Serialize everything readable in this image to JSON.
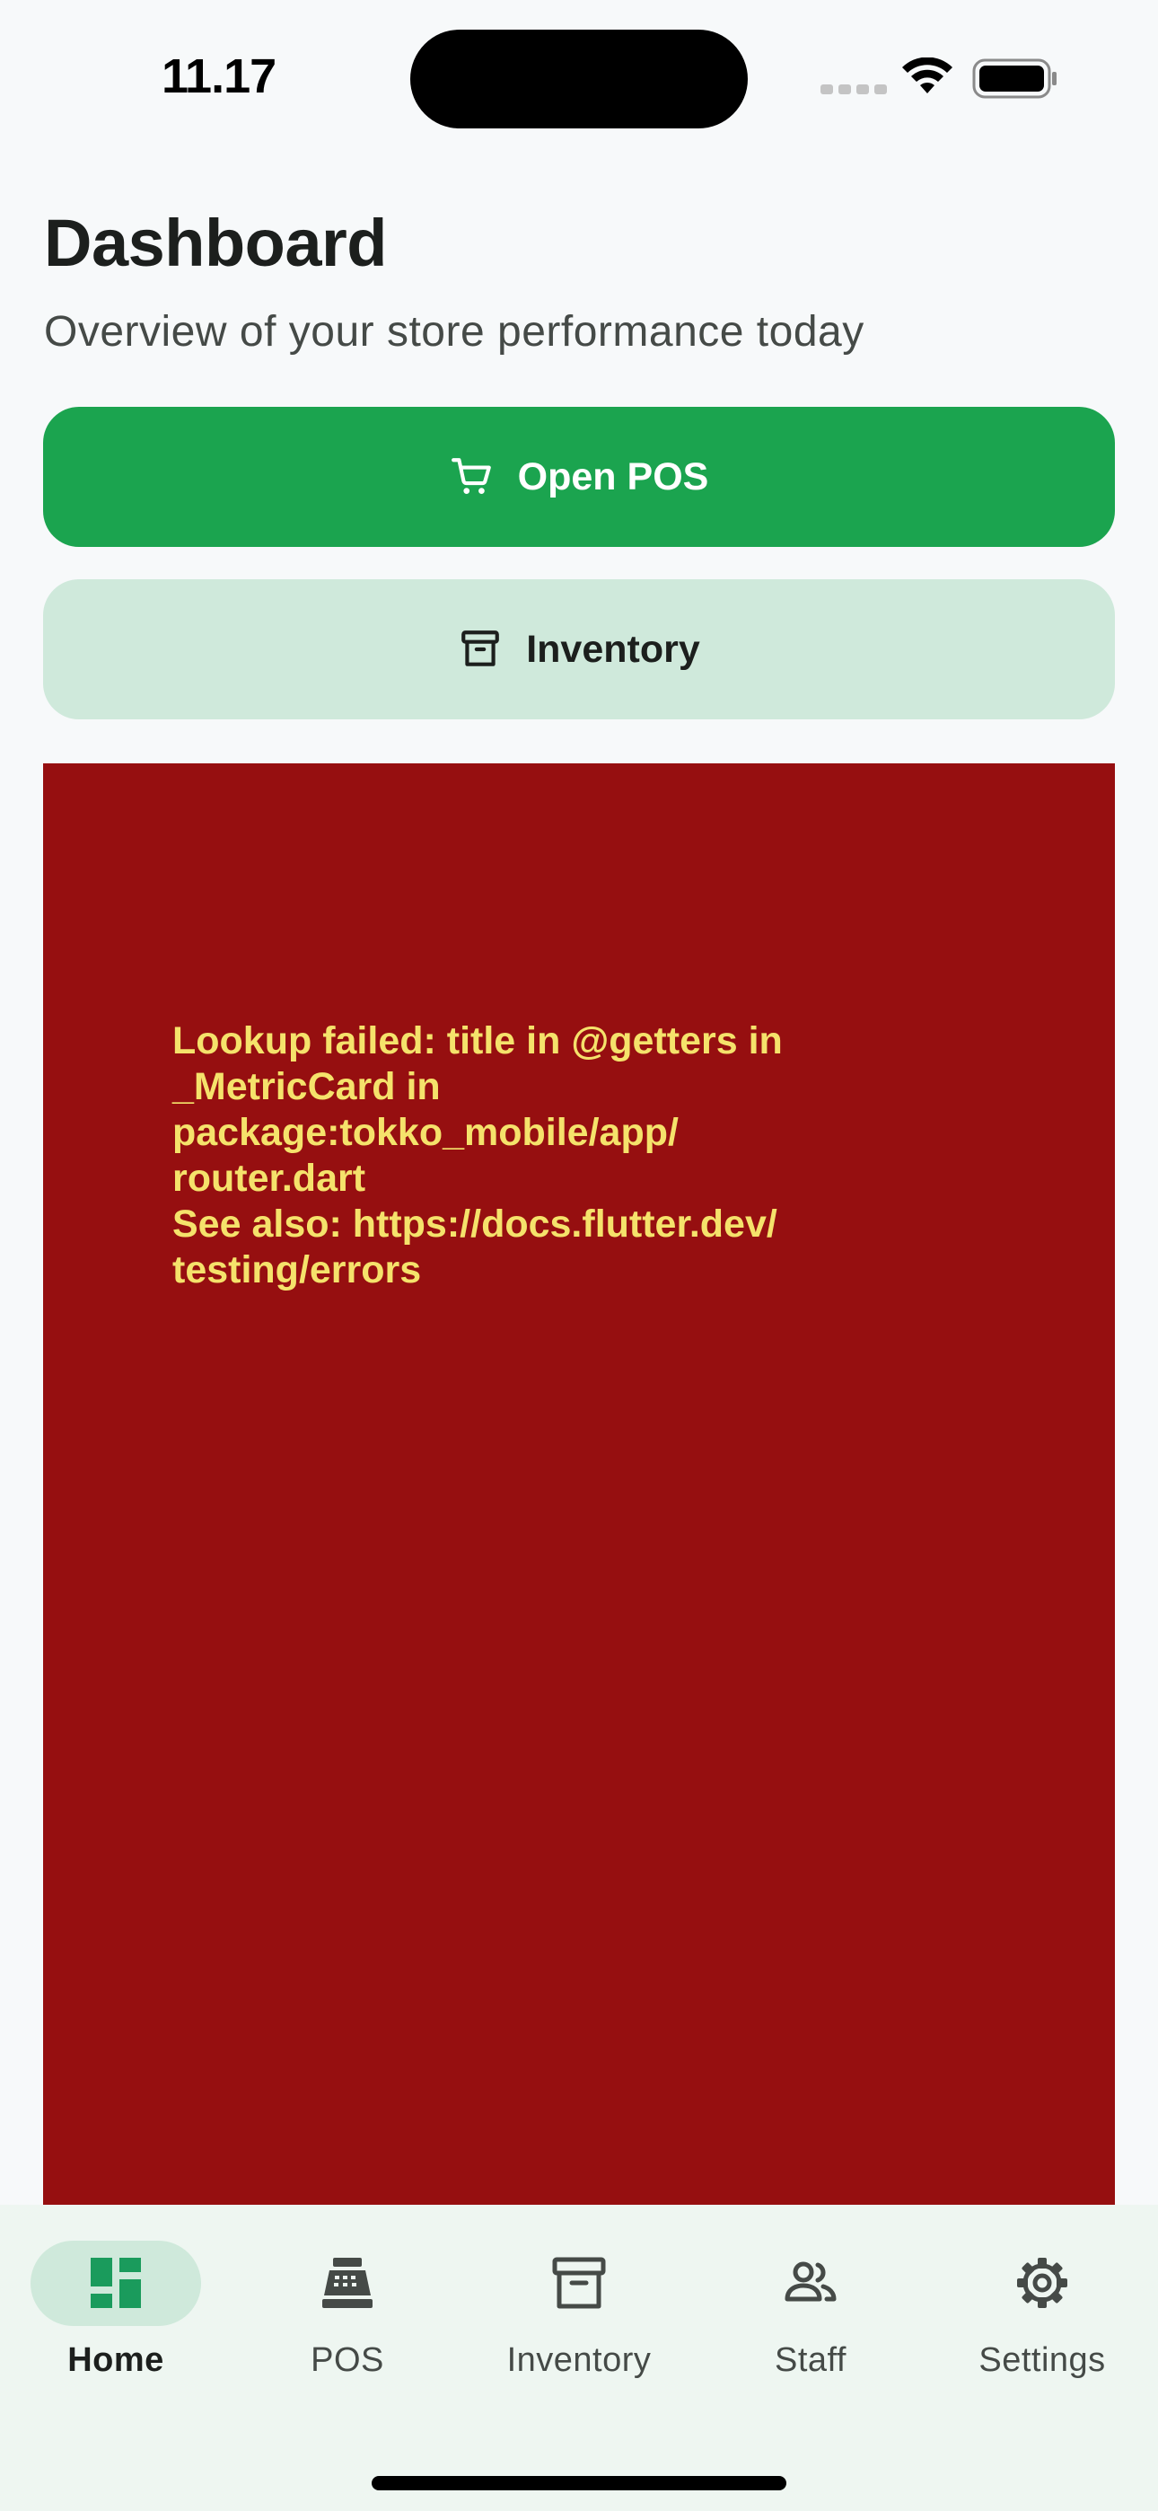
{
  "status_bar": {
    "time": "11.17"
  },
  "header": {
    "title": "Dashboard",
    "subtitle": "Overview of your store performance today"
  },
  "actions": {
    "open_pos_label": "Open POS",
    "open_pos_icon": "cart-icon",
    "inventory_label": "Inventory",
    "inventory_icon": "archive-box-icon"
  },
  "error": {
    "message": "Lookup failed: title in @getters in\n_MetricCard in\npackage:tokko_mobile/app/\nrouter.dart\nSee also: https://docs.flutter.dev/\ntesting/errors"
  },
  "bottom_nav": {
    "active": "Home",
    "items": [
      {
        "label": "Home",
        "icon": "dashboard-icon"
      },
      {
        "label": "POS",
        "icon": "cash-register-icon"
      },
      {
        "label": "Inventory",
        "icon": "archive-box-icon"
      },
      {
        "label": "Staff",
        "icon": "people-icon"
      },
      {
        "label": "Settings",
        "icon": "gear-icon"
      }
    ]
  },
  "colors": {
    "primary": "#1ba44f",
    "primary_container": "#cfe9db",
    "error_background": "#960f10",
    "error_text": "#f5e26b",
    "nav_background": "#eef6f1",
    "active_icon": "#1a9b5c"
  }
}
